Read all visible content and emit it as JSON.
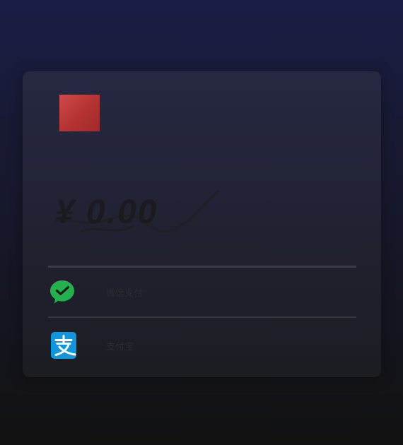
{
  "merchant": {
    "logo_caption": "·"
  },
  "payment": {
    "amount": "¥ 0.00"
  },
  "methods": [
    {
      "id": "wechat",
      "label": "微信支付",
      "icon": "wechat-pay-icon",
      "brand_color": "#22b14c"
    },
    {
      "id": "alipay",
      "label": "支付宝",
      "icon": "alipay-icon",
      "brand_color": "#1296db"
    }
  ],
  "colors": {
    "logo": "#c03a3a",
    "card": "#22232f",
    "divider": "#3a3b46"
  }
}
